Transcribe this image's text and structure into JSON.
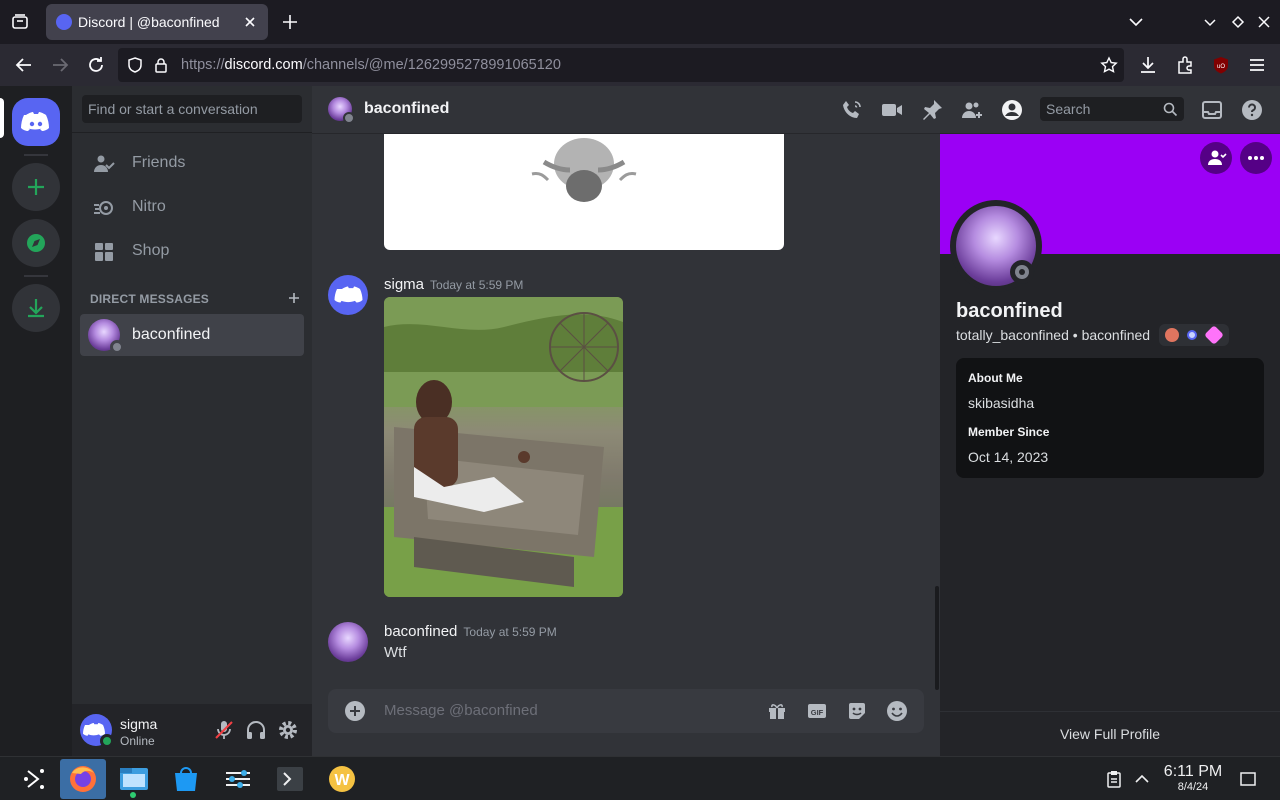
{
  "browser": {
    "tab_title": "Discord | @baconfined",
    "url_prefix": "https://",
    "url_host": "discord.com",
    "url_path": "/channels/@me/1262995278991065120"
  },
  "dm_sidebar": {
    "search_placeholder": "Find or start a conversation",
    "nav": [
      {
        "label": "Friends",
        "icon": "friends-icon"
      },
      {
        "label": "Nitro",
        "icon": "nitro-icon"
      },
      {
        "label": "Shop",
        "icon": "shop-icon"
      }
    ],
    "section_header": "DIRECT MESSAGES",
    "dm_items": [
      {
        "label": "baconfined"
      }
    ]
  },
  "user_panel": {
    "username": "sigma",
    "status": "Online"
  },
  "chat": {
    "recipient": "baconfined",
    "search_placeholder": "Search",
    "messages": [
      {
        "author": "sigma",
        "timestamp": "Today at 5:59 PM"
      },
      {
        "author": "baconfined",
        "timestamp": "Today at 5:59 PM",
        "text": "Wtf"
      }
    ],
    "composer_placeholder": "Message @baconfined"
  },
  "profile": {
    "display_name": "baconfined",
    "username": "totally_baconfined",
    "separator": "•",
    "pronoun_name": "baconfined",
    "about_label": "About Me",
    "about_text": "skibasidha",
    "member_since_label": "Member Since",
    "member_since": "Oct 14, 2023",
    "view_full": "View Full Profile",
    "banner_color": "#9b00f5"
  },
  "taskbar": {
    "time": "6:11 PM",
    "date": "8/4/24"
  },
  "colors": {
    "blurple": "#5865f2",
    "green": "#23a55a",
    "bg": "#313338"
  }
}
